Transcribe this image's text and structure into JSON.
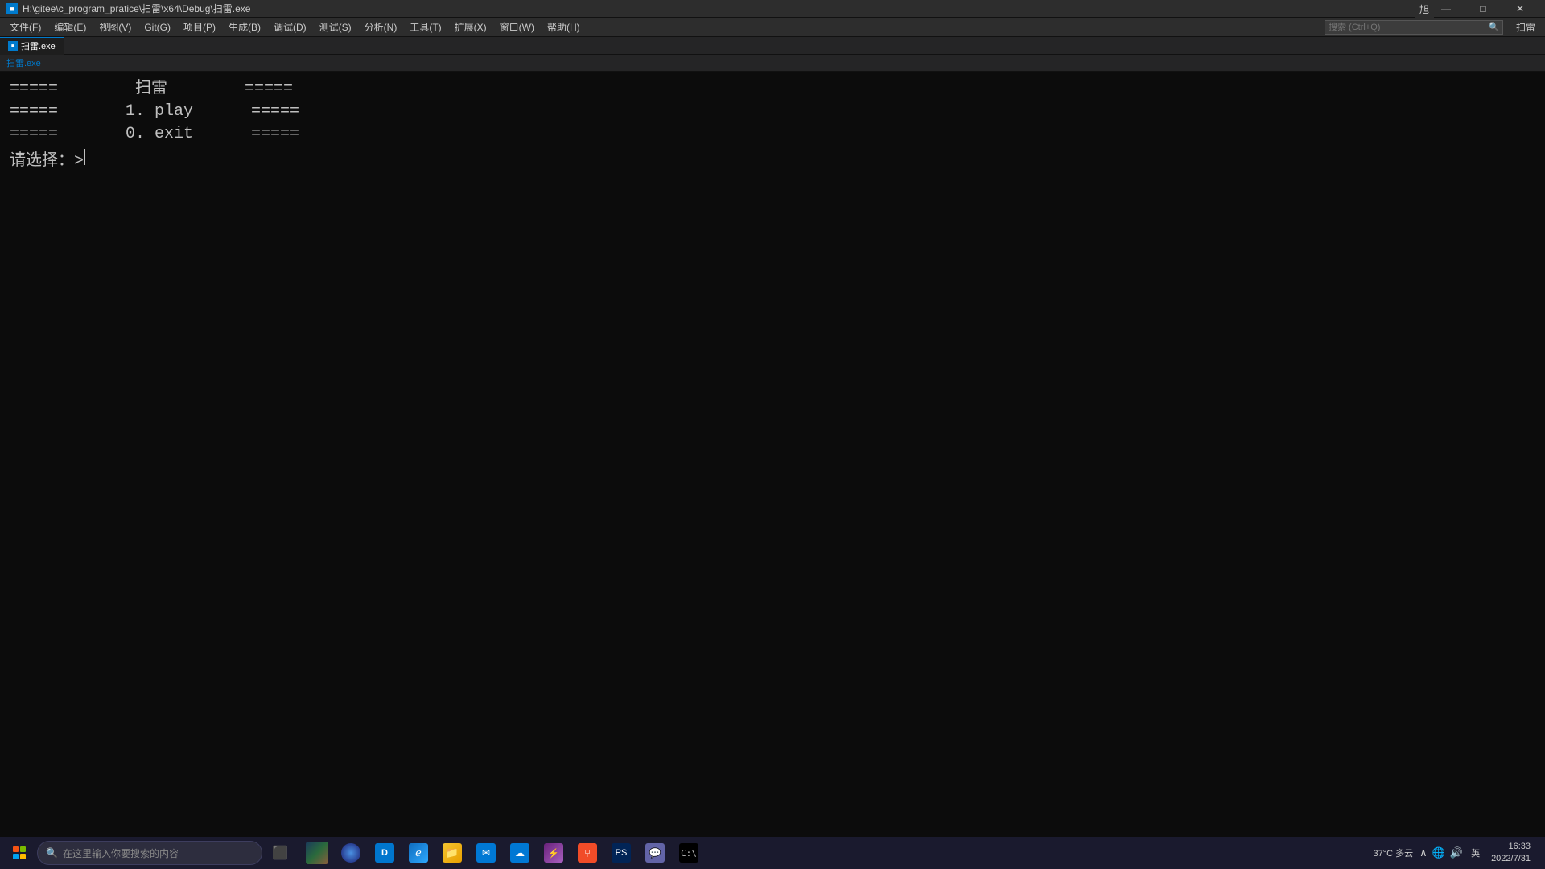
{
  "titlebar": {
    "icon_label": "■",
    "title": "H:\\gitee\\c_program_pratice\\扫雷\\x64\\Debug\\扫雷.exe",
    "minimize_label": "—",
    "maximize_label": "□",
    "close_label": "✕",
    "user_label": "旭"
  },
  "menubar": {
    "items": [
      {
        "label": "文件(F)"
      },
      {
        "label": "编辑(E)"
      },
      {
        "label": "视图(V)"
      },
      {
        "label": "Git(G)"
      },
      {
        "label": "项目(P)"
      },
      {
        "label": "生成(B)"
      },
      {
        "label": "调试(D)"
      },
      {
        "label": "测试(S)"
      },
      {
        "label": "分析(N)"
      },
      {
        "label": "工具(T)"
      },
      {
        "label": "扩展(X)"
      },
      {
        "label": "窗口(W)"
      },
      {
        "label": "帮助(H)"
      }
    ],
    "search_placeholder": "搜索 (Ctrl+Q)",
    "extra_label": "扫雷"
  },
  "tabbar": {
    "tabs": [
      {
        "label": "扫雷.exe",
        "active": true,
        "icon": "■"
      }
    ]
  },
  "terminal": {
    "lines": [
      {
        "content": "=====\t\t扫雷\t\t====="
      },
      {
        "content": "=====\t\t1. play\t\t====="
      },
      {
        "content": "=====\t\t0. exit\t\t====="
      },
      {
        "content": "请选择：>"
      }
    ],
    "line1": "=====        扫雷        =====",
    "line2": "=====       1. play      =====",
    "line3": "=====       0. exit      =====",
    "line4": "请选择：>"
  },
  "taskbar": {
    "search_placeholder": "在这里输入你要搜索的内容",
    "apps": [
      {
        "name": "task-view",
        "symbol": "⬜"
      },
      {
        "name": "explorer",
        "symbol": "📁"
      },
      {
        "name": "cortana",
        "symbol": "◉"
      },
      {
        "name": "edge",
        "symbol": "🌐"
      },
      {
        "name": "dell",
        "symbol": "◆"
      },
      {
        "name": "ie",
        "symbol": "ℯ"
      },
      {
        "name": "files",
        "symbol": "📂"
      },
      {
        "name": "mail",
        "symbol": "✉"
      },
      {
        "name": "onedrive",
        "symbol": "☁"
      },
      {
        "name": "vs",
        "symbol": "⚡"
      },
      {
        "name": "git",
        "symbol": "⑂"
      },
      {
        "name": "terminal",
        "symbol": "⬛"
      },
      {
        "name": "desktop",
        "symbol": "🖥"
      },
      {
        "name": "cmd",
        "symbol": "⬛"
      }
    ],
    "tray": {
      "weather": "37°C 多云",
      "expand": "∧",
      "network": "🌐",
      "speaker": "🔊",
      "ime": "英",
      "time": "16:33",
      "date": "2022/7/31"
    }
  }
}
